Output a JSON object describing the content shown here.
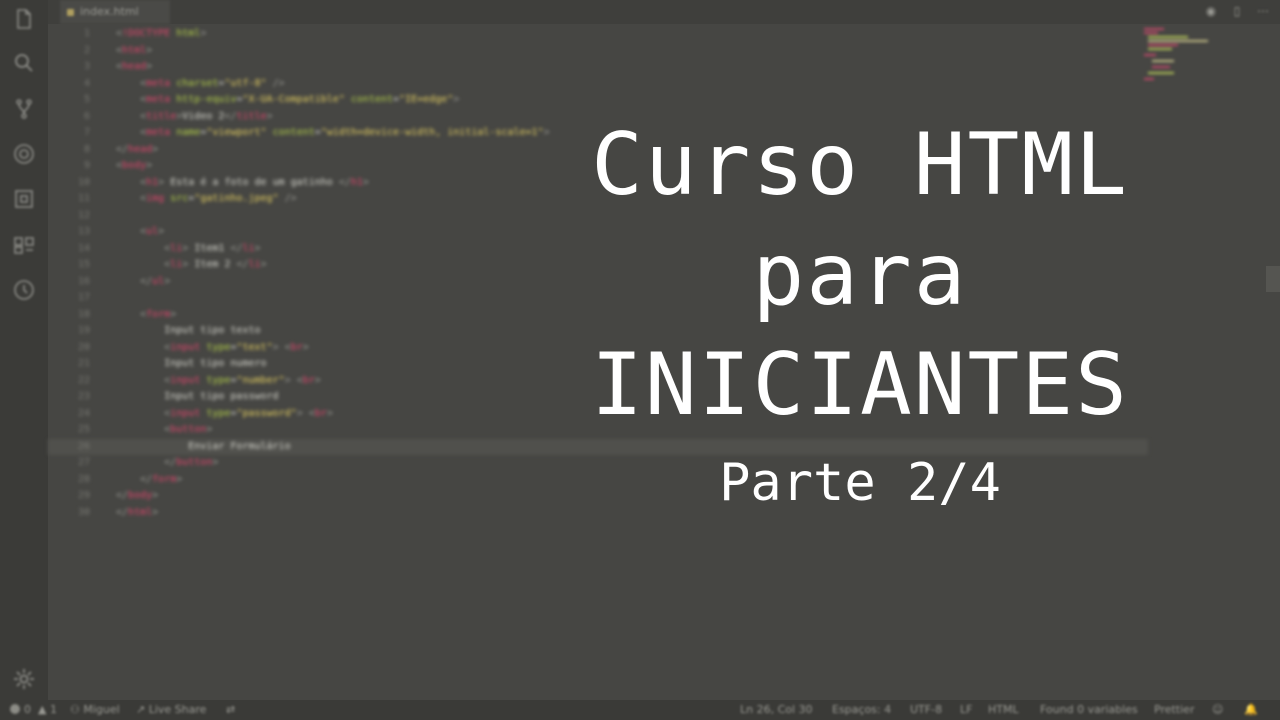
{
  "tab": {
    "filename": "index.html"
  },
  "editor": {
    "lines": [
      {
        "n": "1",
        "html": "<span class='t-br'>&lt;</span><span class='t-tag'>!DOCTYPE</span> <span class='t-attr'>html</span><span class='t-br'>&gt;</span>"
      },
      {
        "n": "2",
        "html": "<span class='t-br'>&lt;</span><span class='t-tag'>html</span><span class='t-br'>&gt;</span>"
      },
      {
        "n": "3",
        "html": "<span class='t-br'>&lt;</span><span class='t-tag'>head</span><span class='t-br'>&gt;</span>"
      },
      {
        "n": "4",
        "html": "    <span class='t-br'>&lt;</span><span class='t-tag'>meta</span> <span class='t-attr'>charset</span>=<span class='t-val'>\"utf-8\"</span> <span class='t-br'>/&gt;</span>"
      },
      {
        "n": "5",
        "html": "    <span class='t-br'>&lt;</span><span class='t-tag'>meta</span> <span class='t-attr'>http-equiv</span>=<span class='t-val'>\"X-UA-Compatible\"</span> <span class='t-attr'>content</span>=<span class='t-val'>\"IE=edge\"</span><span class='t-br'>&gt;</span>"
      },
      {
        "n": "6",
        "html": "    <span class='t-br'>&lt;</span><span class='t-tag'>title</span><span class='t-br'>&gt;</span><span class='t-txt'>Video 2</span><span class='t-br'>&lt;/</span><span class='t-tag'>title</span><span class='t-br'>&gt;</span>"
      },
      {
        "n": "7",
        "html": "    <span class='t-br'>&lt;</span><span class='t-tag'>meta</span> <span class='t-attr'>name</span>=<span class='t-val'>\"viewport\"</span> <span class='t-attr'>content</span>=<span class='t-val'>\"width=device-width, initial-scale=1\"</span><span class='t-br'>&gt;</span>"
      },
      {
        "n": "8",
        "html": "<span class='t-br'>&lt;/</span><span class='t-tag'>head</span><span class='t-br'>&gt;</span>"
      },
      {
        "n": "9",
        "html": "<span class='t-br'>&lt;</span><span class='t-tag'>body</span><span class='t-br'>&gt;</span>"
      },
      {
        "n": "10",
        "html": "    <span class='t-br'>&lt;</span><span class='t-tag'>h1</span><span class='t-br'>&gt;</span> <span class='t-txt'>Esta é a foto de um gatinho</span> <span class='t-br'>&lt;/</span><span class='t-tag'>h1</span><span class='t-br'>&gt;</span>"
      },
      {
        "n": "11",
        "html": "    <span class='t-br'>&lt;</span><span class='t-tag'>img</span> <span class='t-attr'>src</span>=<span class='t-val'>\"gatinho.jpeg\"</span> <span class='t-br'>/&gt;</span>"
      },
      {
        "n": "12",
        "html": ""
      },
      {
        "n": "13",
        "html": "    <span class='t-br'>&lt;</span><span class='t-tag'>ul</span><span class='t-br'>&gt;</span>"
      },
      {
        "n": "14",
        "html": "        <span class='t-br'>&lt;</span><span class='t-tag'>li</span><span class='t-br'>&gt;</span> <span class='t-txt'>Item1</span> <span class='t-br'>&lt;/</span><span class='t-tag'>li</span><span class='t-br'>&gt;</span>"
      },
      {
        "n": "15",
        "html": "        <span class='t-br'>&lt;</span><span class='t-tag'>li</span><span class='t-br'>&gt;</span> <span class='t-txt'>Item 2</span> <span class='t-br'>&lt;/</span><span class='t-tag'>li</span><span class='t-br'>&gt;</span>"
      },
      {
        "n": "16",
        "html": "    <span class='t-br'>&lt;/</span><span class='t-tag'>ul</span><span class='t-br'>&gt;</span>"
      },
      {
        "n": "17",
        "html": ""
      },
      {
        "n": "18",
        "html": "    <span class='t-br'>&lt;</span><span class='t-tag'>form</span><span class='t-br'>&gt;</span>"
      },
      {
        "n": "19",
        "html": "        <span class='t-txt'>Input tipo texto</span>"
      },
      {
        "n": "20",
        "html": "        <span class='t-br'>&lt;</span><span class='t-tag'>input</span> <span class='t-attr'>type</span>=<span class='t-val'>\"text\"</span><span class='t-br'>&gt;</span> <span class='t-br'>&lt;</span><span class='t-tag'>br</span><span class='t-br'>&gt;</span>"
      },
      {
        "n": "21",
        "html": "        <span class='t-txt'>Input tipo numero</span>"
      },
      {
        "n": "22",
        "html": "        <span class='t-br'>&lt;</span><span class='t-tag'>input</span> <span class='t-attr'>type</span>=<span class='t-val'>\"number\"</span><span class='t-br'>&gt;</span> <span class='t-br'>&lt;</span><span class='t-tag'>br</span><span class='t-br'>&gt;</span>"
      },
      {
        "n": "23",
        "html": "        <span class='t-txt'>Input tipo password</span>"
      },
      {
        "n": "24",
        "html": "        <span class='t-br'>&lt;</span><span class='t-tag'>input</span> <span class='t-attr'>type</span>=<span class='t-val'>\"password\"</span><span class='t-br'>&gt;</span> <span class='t-br'>&lt;</span><span class='t-tag'>br</span><span class='t-br'>&gt;</span>"
      },
      {
        "n": "25",
        "html": "        <span class='t-br'>&lt;</span><span class='t-tag'>button</span><span class='t-br'>&gt;</span>"
      },
      {
        "n": "26",
        "html": "            <span class='t-txt'>Enviar Formulário</span>"
      },
      {
        "n": "27",
        "html": "        <span class='t-br'>&lt;/</span><span class='t-tag'>button</span><span class='t-br'>&gt;</span>"
      },
      {
        "n": "28",
        "html": "    <span class='t-br'>&lt;/</span><span class='t-tag'>form</span><span class='t-br'>&gt;</span>"
      },
      {
        "n": "29",
        "html": "<span class='t-br'>&lt;/</span><span class='t-tag'>body</span><span class='t-br'>&gt;</span>"
      },
      {
        "n": "30",
        "html": "<span class='t-br'>&lt;/</span><span class='t-tag'>html</span><span class='t-br'>&gt;</span>"
      }
    ],
    "highlighted_line": 26
  },
  "overlay": {
    "line1": "Curso HTML",
    "line2": "para",
    "line3": "INICIANTES",
    "sub": "Parte 2/4"
  },
  "status": {
    "errors": "0",
    "warnings": "1",
    "user": "Miguel",
    "live_share": "Live Share",
    "position": "Ln 26, Col 30",
    "spaces": "Espaços: 4",
    "encoding": "UTF-8",
    "eol": "LF",
    "language": "HTML",
    "variables": "Found 0 variables",
    "prettier": "Prettier"
  }
}
